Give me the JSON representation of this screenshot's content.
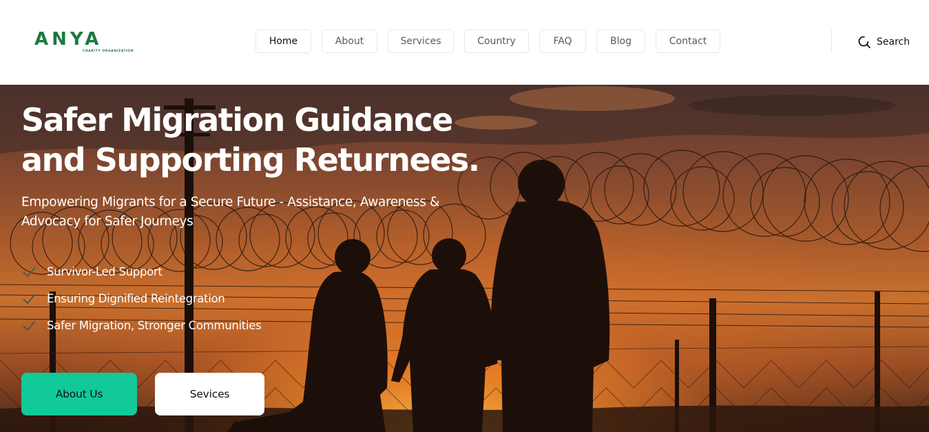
{
  "logo": {
    "wordmark": "ANYA",
    "tagline": "CHARITY ORGANIZATION",
    "color": "#1d7a3e"
  },
  "nav": {
    "items": [
      {
        "label": "Home",
        "active": true
      },
      {
        "label": "About",
        "active": false
      },
      {
        "label": "Services",
        "active": false
      },
      {
        "label": "Country",
        "active": false
      },
      {
        "label": "FAQ",
        "active": false
      },
      {
        "label": "Blog",
        "active": false
      },
      {
        "label": "Contact",
        "active": false
      }
    ]
  },
  "search": {
    "label": "Search",
    "icon": "search-icon"
  },
  "hero": {
    "title_line1": "Safer Migration Guidance",
    "title_line2": "and Supporting Returnees.",
    "subtitle": "Empowering Migrants for a Secure Future - Assistance, Awareness & Advocacy for Safer Journeys",
    "features": [
      {
        "label": "Survivor-Led Support",
        "icon": "check-icon"
      },
      {
        "label": "Ensuring Dignified Reintegration",
        "icon": "check-icon"
      },
      {
        "label": "Safer Migration, Stronger Communities",
        "icon": "check-icon"
      }
    ],
    "buttons": {
      "about": "About Us",
      "services": "Sevices"
    },
    "background_image": "silhouettes of an adult and two children at a razor-wire fence at sunset"
  },
  "colors": {
    "accent": "#12c99a",
    "brand": "#1d7a3e",
    "nav_border": "#e5e7eb"
  }
}
